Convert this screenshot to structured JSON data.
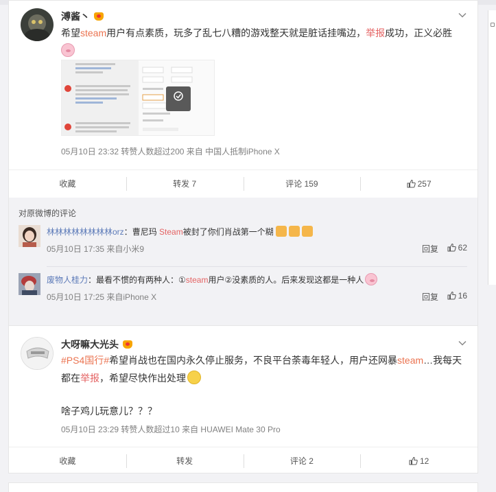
{
  "posts": [
    {
      "username": "溥酱丶",
      "text_parts": [
        "希望",
        "steam",
        "用户有点素质，玩多了乱七八糟的游戏整天就是脏话挂嘴边，",
        "举报",
        "成功，正义必胜"
      ],
      "meta": "05月10日 23:32 转赞人数超过200 来自 中国人抵制iPhone X",
      "actions": {
        "collect": "收藏",
        "forward": "转发 7",
        "comment": "评论 159",
        "like": "257"
      },
      "comments_title": "对原微博的评论",
      "comments": [
        {
          "name": "林林林林林林林林orz",
          "sep": "：",
          "text_parts": [
            "曹尼玛 ",
            "Steam",
            "被封了你们肖战第一个糊"
          ],
          "meta": "05月10日 17:35 来自小米9",
          "reply": "回复",
          "likes": "62"
        },
        {
          "name": "废物人桂力",
          "sep": "：",
          "text_parts": [
            "最看不惯的有两种人：①",
            "steam",
            "用户②没素质的人。后来发现这都是一种人"
          ],
          "meta": "05月10日 17:25 来自iPhone X",
          "reply": "回复",
          "likes": "16"
        }
      ]
    },
    {
      "username": "大呀嘛大光头",
      "text_parts": [
        "#PS4国行#",
        "希望肖战也在国内永久停止服务，不良平台荼毒年轻人，用户还网暴",
        "steam",
        "…",
        "我每天都在",
        "举报",
        "，希望尽快作出处理"
      ],
      "text2": "啥子鸡儿玩意儿？？？",
      "meta": "05月10日 23:29 转赞人数超过10 来自 HUAWEI Mate 30 Pro",
      "actions": {
        "collect": "收藏",
        "forward": "转发",
        "comment": "评论 2",
        "like": "12"
      }
    }
  ],
  "colors": {
    "link": "#eb7350",
    "name": "#5c7ab8",
    "meta": "#808080"
  }
}
